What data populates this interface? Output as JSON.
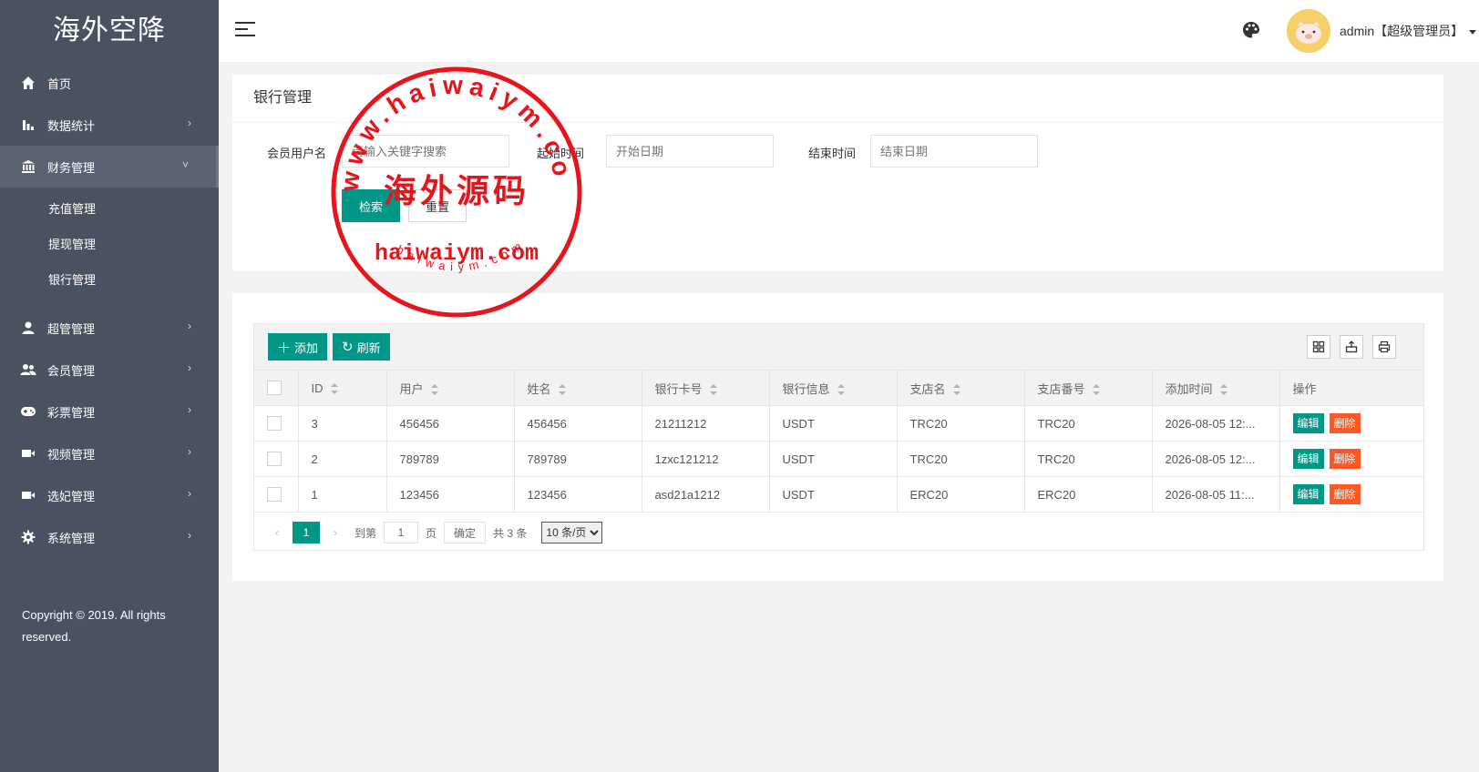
{
  "brand": "海外空降",
  "sidebar": {
    "items": [
      {
        "label": "首页",
        "icon": "home-icon"
      },
      {
        "label": "数据统计",
        "icon": "bar-chart-icon",
        "arrow": "›"
      },
      {
        "label": "财务管理",
        "icon": "bank-icon",
        "arrow": "˅"
      },
      {
        "label": "超管管理",
        "icon": "user-icon",
        "arrow": "›"
      },
      {
        "label": "会员管理",
        "icon": "users-icon",
        "arrow": "›"
      },
      {
        "label": "彩票管理",
        "icon": "gamepad-icon",
        "arrow": "›"
      },
      {
        "label": "视频管理",
        "icon": "video-icon",
        "arrow": "›"
      },
      {
        "label": "选妃管理",
        "icon": "video-icon",
        "arrow": "›"
      },
      {
        "label": "系统管理",
        "icon": "gear-icon",
        "arrow": "›"
      }
    ],
    "submenu": [
      "充值管理",
      "提现管理",
      "银行管理"
    ],
    "copyright": "Copyright © 2019. All rights reserved."
  },
  "header": {
    "user": "admin【超级管理员】"
  },
  "search": {
    "title": "银行管理",
    "member_label": "会员用户名",
    "member_placeholder": "请输入关键字搜索",
    "start_label": "起始时间",
    "start_placeholder": "开始日期",
    "end_label": "结束时间",
    "end_placeholder": "结束日期",
    "search_button": "检索",
    "reset_button": "重置"
  },
  "table": {
    "add_button": "添加",
    "refresh_button": "刷新",
    "columns": [
      "ID",
      "用户",
      "姓名",
      "银行卡号",
      "银行信息",
      "支店名",
      "支店番号",
      "添加时间",
      "操作"
    ],
    "rows": [
      [
        "3",
        "456456",
        "456456",
        "21211212",
        "USDT",
        "TRC20",
        "TRC20",
        "2026-08-05 12:..."
      ],
      [
        "2",
        "789789",
        "789789",
        "1zxc121212",
        "USDT",
        "TRC20",
        "TRC20",
        "2026-08-05 12:..."
      ],
      [
        "1",
        "123456",
        "123456",
        "asd21a1212",
        "USDT",
        "ERC20",
        "ERC20",
        "2026-08-05 11:..."
      ]
    ],
    "edit_label": "编辑",
    "delete_label": "删除"
  },
  "pager": {
    "current": "1",
    "goto_label": "到第",
    "goto_value": "1",
    "page_label": "页",
    "confirm": "确定",
    "total": "共 3 条",
    "page_size": "10 条/页"
  },
  "watermark": {
    "ring_text": "www.haiwaiym.com",
    "center_text": "海外源码",
    "domain_text": "haiwaiym.com",
    "bottom_text": "haiwaiym.com",
    "color": "#e8141b"
  },
  "colors": {
    "sidebar": "#4a5262",
    "primary": "#009688",
    "danger": "#ff5722"
  }
}
